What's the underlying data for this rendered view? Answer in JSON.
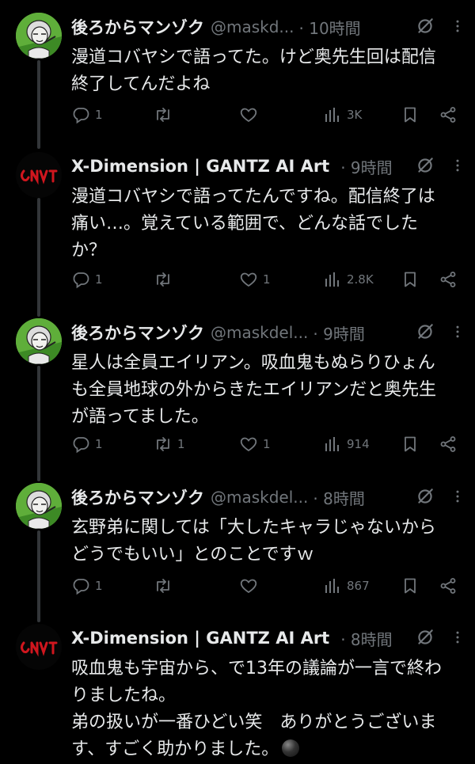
{
  "tweets": [
    {
      "avatar": "old-man-avatar",
      "name": "後ろからマンゾク",
      "handle": "@maskd...",
      "time": "· 10時間",
      "text": "漫道コバヤシで語ってた。けど奥先生回は配信\n終了してんだよね",
      "reply_count": "1",
      "retweet_count": "",
      "like_count": "",
      "view_count": "3K"
    },
    {
      "avatar": "gantz-logo-avatar",
      "name": "X-Dimension | GANTZ AI Art",
      "handle": "",
      "time": "· 9時間",
      "text": "漫道コバヤシで語ってたんですね。配信終了は\n痛い…。覚えている範囲で、どんな話でした\nか？",
      "reply_count": "1",
      "retweet_count": "",
      "like_count": "1",
      "view_count": "2.8K"
    },
    {
      "avatar": "old-man-avatar",
      "name": "後ろからマンゾク",
      "handle": "@maskdel...",
      "time": "· 9時間",
      "text": "星人は全員エイリアン。吸血鬼もぬらりひょん\nも全員地球の外からきたエイリアンだと奥先生\nが語ってました。",
      "reply_count": "1",
      "retweet_count": "1",
      "like_count": "1",
      "view_count": "914"
    },
    {
      "avatar": "old-man-avatar",
      "name": "後ろからマンゾク",
      "handle": "@maskdel...",
      "time": "· 8時間",
      "text": "玄野弟に関しては「大したキャラじゃないから\nどうでもいい」とのことですｗ",
      "reply_count": "1",
      "retweet_count": "",
      "like_count": "",
      "view_count": "867"
    },
    {
      "avatar": "gantz-logo-avatar",
      "name": "X-Dimension | GANTZ AI Art",
      "handle": "",
      "time": "· 8時間",
      "text": "吸血鬼も宇宙から、で13年の議論が一言で終わ\nりましたね。\n弟の扱いが一番ひどい笑　ありがとうございま\nす、すごく助かりました。",
      "text_emoji": "black-circle-emoji"
    }
  ],
  "colors": {
    "background": "#000000",
    "text": "#e7e9ea",
    "secondary": "#71767b",
    "thread_line": "#333639"
  }
}
